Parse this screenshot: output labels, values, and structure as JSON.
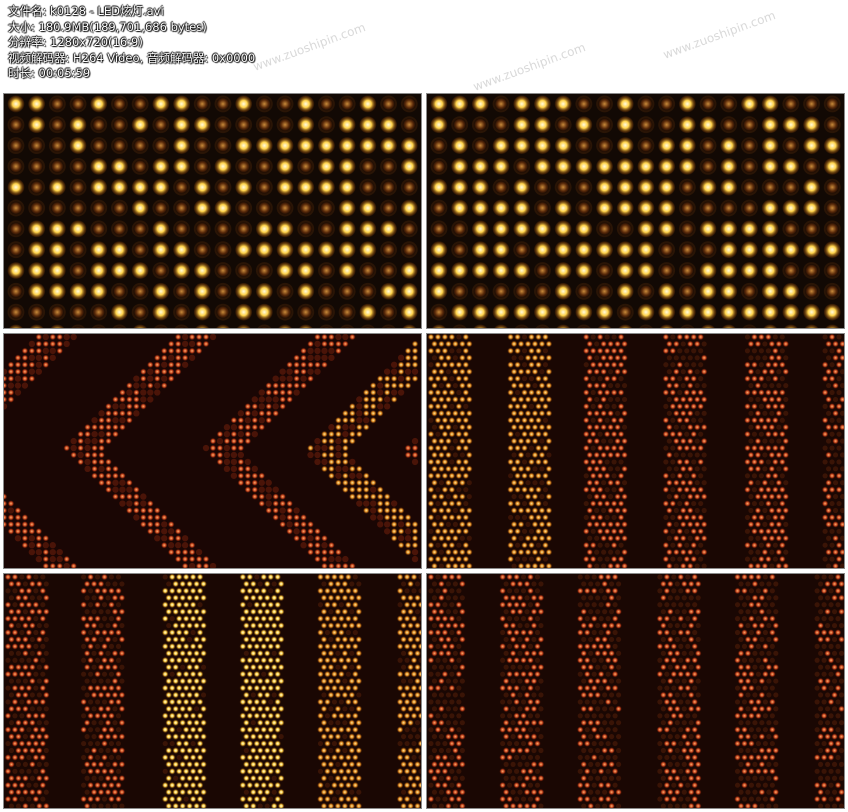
{
  "info": {
    "filename": "文件名: k0128 - LED炫灯.avi",
    "size": "大小: 180.9MB(189,701,686 bytes)",
    "resolution": "分辨率: 1280x720(16:9)",
    "codec": "视频解码器: H264 Video, 音频解码器: 0x0000",
    "duration": "时长: 00:05:59"
  },
  "watermark": "www.zuoshipin.com",
  "thumbnails": [
    {
      "style": "bulb-grid",
      "palette": "gold"
    },
    {
      "style": "bulb-grid",
      "palette": "gold"
    },
    {
      "style": "chevrons",
      "palette": "red-gold"
    },
    {
      "style": "vertical-stripes",
      "palette": "orange"
    },
    {
      "style": "vertical-stripes",
      "palette": "gold-red"
    },
    {
      "style": "vertical-stripes",
      "palette": "dark-red"
    }
  ]
}
